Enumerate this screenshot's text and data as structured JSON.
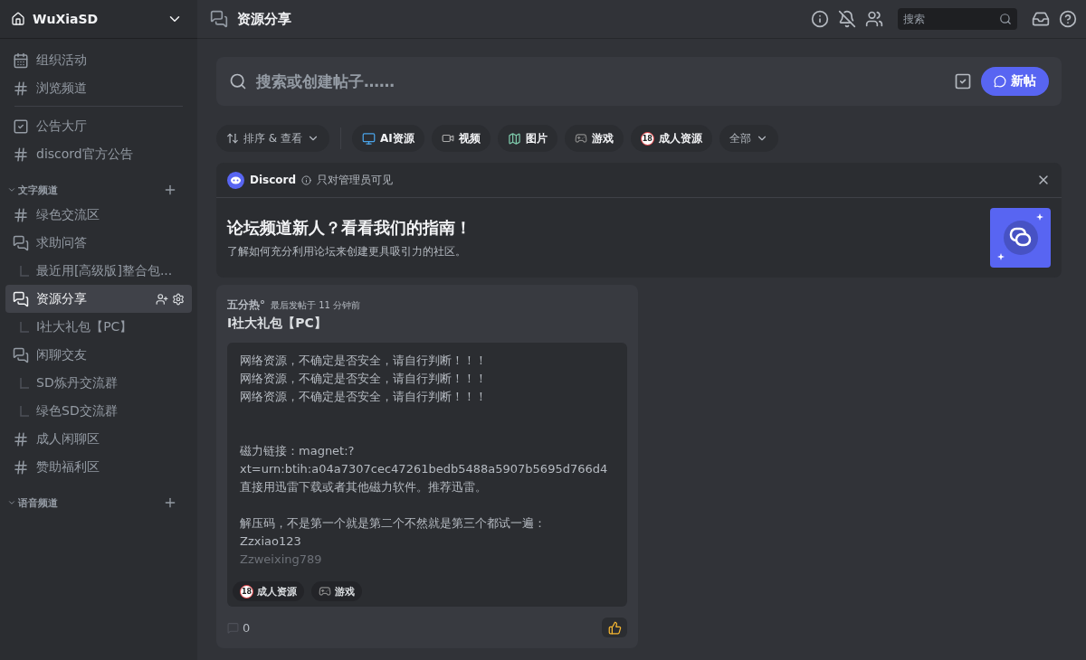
{
  "server": {
    "name": "WuXiaSD"
  },
  "top_items": [
    {
      "kind": "events",
      "label": "组织活动"
    },
    {
      "kind": "browse",
      "label": "浏览频道"
    }
  ],
  "pinned": [
    {
      "kind": "announcement",
      "label": "公告大厅",
      "selected": false
    },
    {
      "kind": "text_locked",
      "label": "discord官方公告",
      "selected": false
    }
  ],
  "sections": [
    {
      "title": "文字频道",
      "channels": [
        {
          "kind": "text",
          "label": "绿色交流区",
          "selected": false
        },
        {
          "kind": "forum",
          "label": "求助问答",
          "selected": false
        },
        {
          "kind": "thread",
          "label": "最近用[高级版]整合包...",
          "selected": false
        },
        {
          "kind": "forum_locked",
          "label": "资源分享",
          "selected": true
        },
        {
          "kind": "thread",
          "label": "I社大礼包【PC】",
          "selected": false
        },
        {
          "kind": "forum_locked",
          "label": "闲聊交友",
          "selected": false
        },
        {
          "kind": "thread_mid",
          "label": "SD炼丹交流群",
          "selected": false
        },
        {
          "kind": "thread",
          "label": "绿色SD交流群",
          "selected": false
        },
        {
          "kind": "text_locked",
          "label": "成人闲聊区",
          "selected": false
        },
        {
          "kind": "text_locked",
          "label": "赞助福利区",
          "selected": false
        }
      ]
    },
    {
      "title": "语音频道"
    }
  ],
  "header": {
    "title": "资源分享",
    "search": {
      "placeholder": "搜索"
    }
  },
  "composer": {
    "placeholder": "搜索或创建帖子……",
    "new_button": "新帖"
  },
  "filters": {
    "sort": "排序 & 查看",
    "tags": [
      {
        "kind": "monitor",
        "label": "AI资源"
      },
      {
        "kind": "video",
        "label": "视频"
      },
      {
        "kind": "map",
        "label": "图片"
      },
      {
        "kind": "game",
        "label": "游戏"
      },
      {
        "kind": "badge",
        "badge": "18",
        "label": "成人资源"
      }
    ],
    "all": "全部"
  },
  "notice": {
    "author": "Discord",
    "visibility": "只对管理员可见",
    "title": "论坛频道新人？看看我们的指南！",
    "subtitle": "了解如何充分利用论坛来创建更具吸引力的社区。"
  },
  "post": {
    "author": "五分热°",
    "time": "最后发帖于 11 分钟前",
    "title": "I社大礼包【PC】",
    "paragraphs": [
      [
        "网络资源，不确定是否安全，请自行判断！！！",
        "网络资源，不确定是否安全，请自行判断！！！",
        "网络资源，不确定是否安全，请自行判断！！！"
      ],
      [
        "磁力链接：magnet:?",
        "xt=urn:btih:a04a7307cec47261bedb5488a5907b5695d766d4",
        "直接用迅雷下载或者其他磁力软件。推荐迅雷。"
      ],
      [
        "解压码，不是第一个就是第二个不然就是第三个都试一遍：",
        "Zzxiao123",
        "Zzweixing789"
      ]
    ],
    "tags": [
      {
        "kind": "badge",
        "badge": "18",
        "label": "成人资源"
      },
      {
        "kind": "game",
        "label": "游戏"
      }
    ],
    "comments": "0"
  }
}
